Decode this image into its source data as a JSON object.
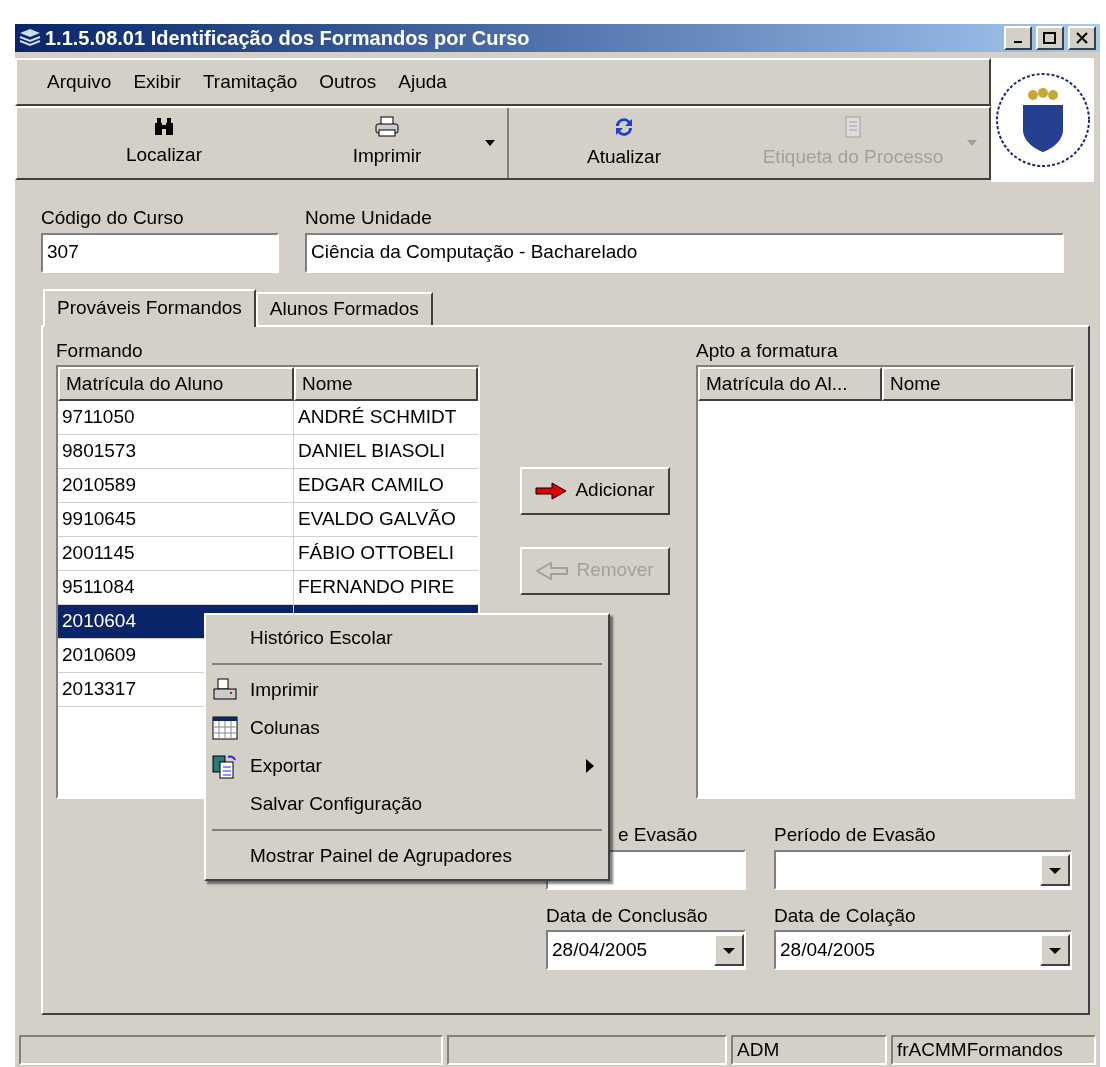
{
  "window": {
    "title": "1.1.5.08.01 Identificação dos Formandos por Curso"
  },
  "menu_bar": [
    "Arquivo",
    "Exibir",
    "Tramitação",
    "Outros",
    "Ajuda"
  ],
  "toolbar": [
    {
      "label": "Localizar",
      "disabled": false,
      "dropdown": false
    },
    {
      "label": "Imprimir",
      "disabled": false,
      "dropdown": true
    },
    {
      "label": "Atualizar",
      "disabled": false,
      "dropdown": false
    },
    {
      "label": "Etiqueta do Processo",
      "disabled": true,
      "dropdown": true
    }
  ],
  "course": {
    "code_label": "Código do Curso",
    "code": "307",
    "unit_label": "Nome Unidade",
    "unit": "Ciência da Computação - Bacharelado"
  },
  "tabs": [
    {
      "label": "Prováveis Formandos",
      "selected": true
    },
    {
      "label": "Alunos Formados",
      "selected": false
    }
  ],
  "formando": {
    "title": "Formando",
    "columns": [
      "Matrícula do Aluno",
      "Nome"
    ],
    "rows": [
      {
        "id": "9711050",
        "name": "ANDRÉ SCHMIDT",
        "selected": false
      },
      {
        "id": "9801573",
        "name": "DANIEL BIASOLI",
        "selected": false
      },
      {
        "id": "2010589",
        "name": "EDGAR CAMILO",
        "selected": false
      },
      {
        "id": "9910645",
        "name": "EVALDO GALVÃO",
        "selected": false
      },
      {
        "id": "2001145",
        "name": "FÁBIO OTTOBELI",
        "selected": false
      },
      {
        "id": "9511084",
        "name": "FERNANDO PIRE",
        "selected": false
      },
      {
        "id": "2010604",
        "selected": true
      },
      {
        "id": "2010609",
        "selected": false
      },
      {
        "id": "2013317",
        "selected": false
      }
    ]
  },
  "actions": [
    {
      "label": "Adicionar",
      "disabled": false
    },
    {
      "label": "Remover",
      "disabled": true
    }
  ],
  "apto": {
    "title": "Apto a formatura",
    "columns": [
      "Matrícula do Al...",
      "Nome"
    ]
  },
  "fields": [
    {
      "label": "e Evasão",
      "kind": "text"
    },
    {
      "label": "Período de Evasão",
      "kind": "combo"
    },
    {
      "label": "Data de Conclusão",
      "kind": "combo",
      "value": "28/04/2005"
    },
    {
      "label": "Data de Colação",
      "kind": "combo",
      "value": "28/04/2005"
    }
  ],
  "context_menu": [
    [
      {
        "label": "Histórico Escolar",
        "submenu": false
      }
    ],
    [
      {
        "label": "Imprimir",
        "submenu": false
      },
      {
        "label": "Colunas",
        "submenu": false
      },
      {
        "label": "Exportar",
        "submenu": true
      },
      {
        "label": "Salvar Configuração",
        "submenu": false
      }
    ],
    [
      {
        "label": "Mostrar Painel de Agrupadores",
        "submenu": false
      }
    ]
  ],
  "status_bar": [
    "ADM",
    "frACMMFormandos"
  ]
}
